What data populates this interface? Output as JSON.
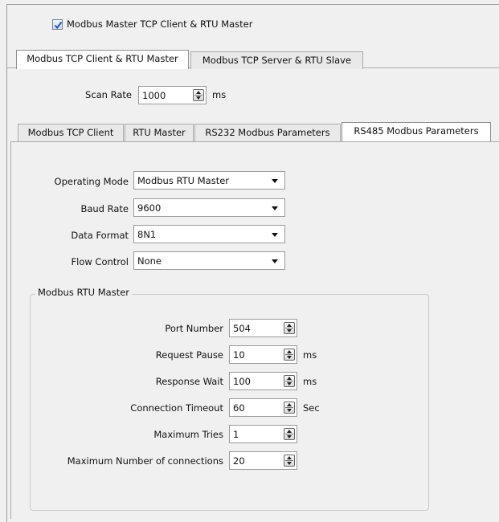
{
  "master_checkbox": {
    "label": "Modbus Master TCP Client & RTU Master",
    "checked": true
  },
  "top_tabs": [
    {
      "label": "Modbus TCP Client & RTU Master",
      "active": true
    },
    {
      "label": "Modbus TCP Server & RTU Slave",
      "active": false
    }
  ],
  "scan_rate": {
    "label": "Scan Rate",
    "value": "1000",
    "unit": "ms"
  },
  "sub_tabs": [
    {
      "label": "Modbus TCP Client",
      "active": false
    },
    {
      "label": "RTU Master",
      "active": false
    },
    {
      "label": "RS232 Modbus Parameters",
      "active": false
    },
    {
      "label": "RS485 Modbus Parameters",
      "active": true
    }
  ],
  "serial": {
    "operating_mode": {
      "label": "Operating Mode",
      "value": "Modbus RTU Master"
    },
    "baud_rate": {
      "label": "Baud Rate",
      "value": "9600"
    },
    "data_format": {
      "label": "Data Format",
      "value": "8N1"
    },
    "flow_control": {
      "label": "Flow Control",
      "value": "None"
    }
  },
  "rtu_group": {
    "title": "Modbus RTU Master",
    "fields": [
      {
        "label": "Port Number",
        "value": "504",
        "unit": ""
      },
      {
        "label": "Request Pause",
        "value": "10",
        "unit": "ms"
      },
      {
        "label": "Response Wait",
        "value": "100",
        "unit": "ms"
      },
      {
        "label": "Connection Timeout",
        "value": "60",
        "unit": "Sec"
      },
      {
        "label": "Maximum Tries",
        "value": "1",
        "unit": ""
      },
      {
        "label": "Maximum Number of connections",
        "value": "20",
        "unit": ""
      }
    ]
  },
  "colors": {
    "checkbox_accent": "#2b54b8",
    "panel_bg": "#f0f0f0",
    "active_tab_bg": "#ffffff"
  }
}
